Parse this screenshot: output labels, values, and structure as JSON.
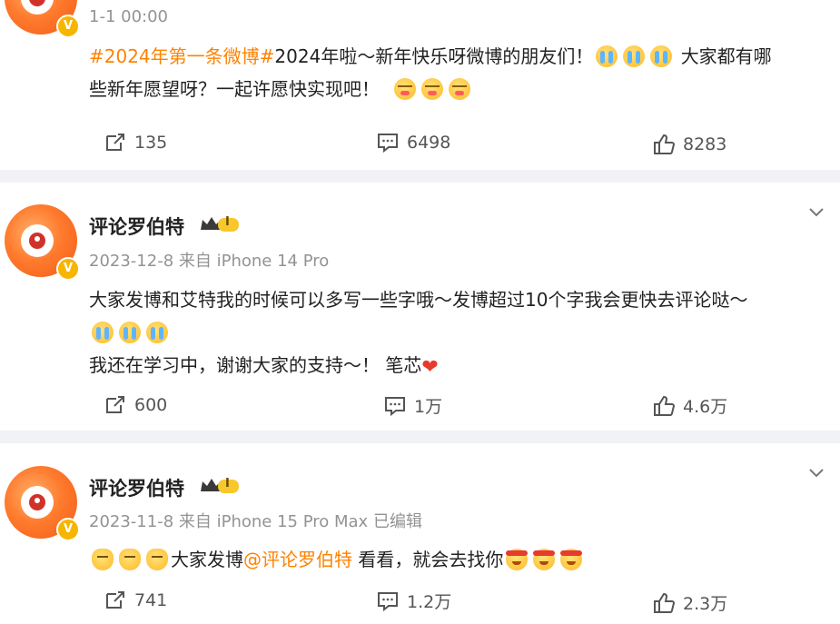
{
  "colors": {
    "accent": "#ff8200",
    "badge": "#f7b500",
    "separator": "#f1f2f5"
  },
  "posts": [
    {
      "time": "1-1 00:00",
      "line1_topic": "#2024年第一条微博#",
      "line1_text": "2024年啦～新年快乐呀微博的朋友们！",
      "line1_tail": "大家都有哪",
      "line2_text": "些新年愿望呀？一起许愿快实现吧！",
      "emoji_icons": [
        "cry-emoji",
        "kiss-emoji"
      ],
      "repost": "135",
      "comment": "6498",
      "like": "8283"
    },
    {
      "name": "评论罗伯特",
      "level_badge": "I",
      "time": "2023-12-8",
      "source": "来自 iPhone 14 Pro",
      "line1": "大家发博和艾特我的时候可以多写一些字哦～发博超过10个字我会更快去评论哒～",
      "line3": "我还在学习中，谢谢大家的支持～！ 笔芯",
      "repost": "600",
      "comment": "1万",
      "like": "4.6万"
    },
    {
      "name": "评论罗伯特",
      "level_badge": "I",
      "time": "2023-11-8",
      "source": "来自 iPhone 15 Pro Max",
      "edited": "已编辑",
      "text_a": "大家发博",
      "mention": "@评论罗伯特",
      "text_b": " 看看，就会去找你",
      "repost": "741",
      "comment": "1.2万",
      "like": "2.3万"
    }
  ],
  "avatar_badge": "V"
}
